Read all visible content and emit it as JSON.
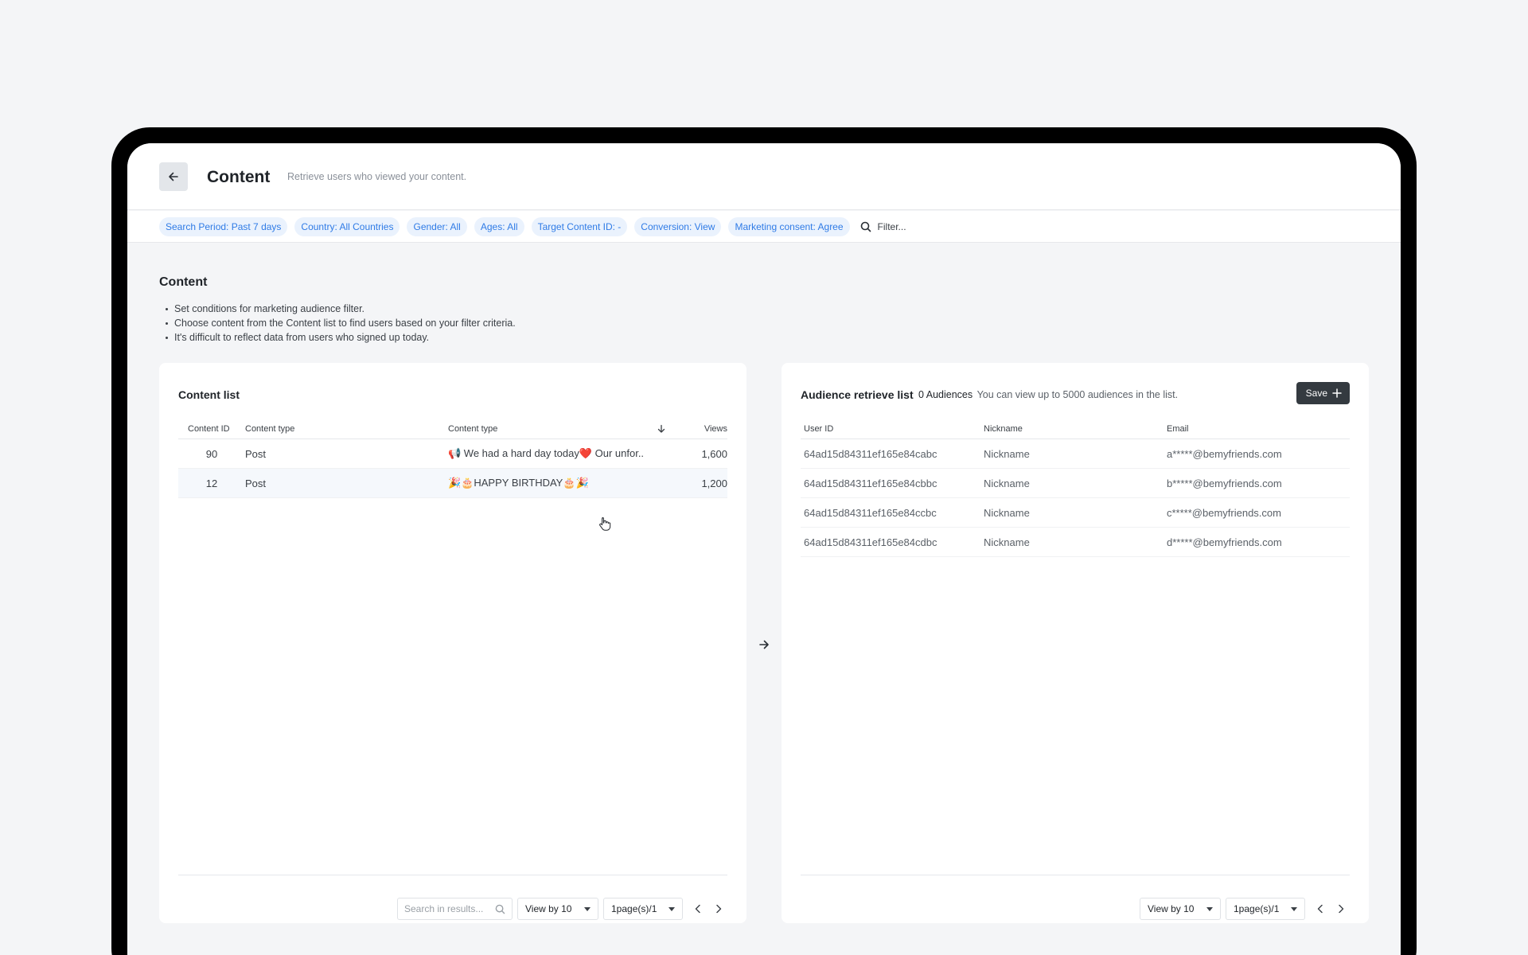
{
  "header": {
    "title": "Content",
    "subtitle": "Retrieve users who viewed your content."
  },
  "filters": {
    "chips": [
      "Search Period: Past 7 days",
      "Country: All Countries",
      "Gender: All",
      "Ages: All",
      "Target Content ID: -",
      "Conversion: View",
      "Marketing consent: Agree"
    ],
    "search_placeholder": "Filter..."
  },
  "section": {
    "title": "Content",
    "bullets": [
      "Set conditions for marketing audience filter.",
      "Choose content from the Content list to find users based on your filter criteria.",
      "It's difficult to reflect data from users who signed up today."
    ]
  },
  "content_list": {
    "title": "Content list",
    "columns": [
      "Content ID",
      "Content type",
      "Content type",
      "Views"
    ],
    "rows": [
      {
        "id": "90",
        "type": "Post",
        "title": "📢 We had a hard day today❤️ Our unfor..",
        "views": "1,600"
      },
      {
        "id": "12",
        "type": "Post",
        "title": "🎉🎂HAPPY BIRTHDAY🎂🎉",
        "views": "1,200"
      }
    ],
    "search_placeholder": "Search in results...",
    "view_by": "View by 10",
    "page": "1page(s)/1"
  },
  "audience_list": {
    "title": "Audience retrieve list",
    "count": "0 Audiences",
    "note": "You can view up to 5000 audiences in the list.",
    "save_label": "Save",
    "columns": [
      "User ID",
      "Nickname",
      "Email"
    ],
    "rows": [
      {
        "uid": "64ad15d84311ef165e84cabc",
        "nick": "Nickname",
        "email": "a*****@bemyfriends.com"
      },
      {
        "uid": "64ad15d84311ef165e84cbbc",
        "nick": "Nickname",
        "email": "b*****@bemyfriends.com"
      },
      {
        "uid": "64ad15d84311ef165e84ccbc",
        "nick": "Nickname",
        "email": "c*****@bemyfriends.com"
      },
      {
        "uid": "64ad15d84311ef165e84cdbc",
        "nick": "Nickname",
        "email": "d*****@bemyfriends.com"
      }
    ],
    "view_by": "View by 10",
    "page": "1page(s)/1"
  },
  "colors": {
    "chip_bg": "#eaf2fd",
    "chip_text": "#2f7be6",
    "save_bg": "#343a40",
    "row_highlight": "#f5f8fc"
  }
}
